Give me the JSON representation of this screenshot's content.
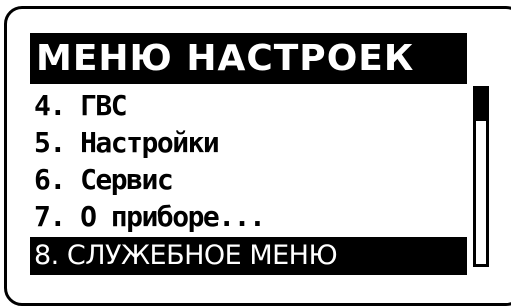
{
  "menu": {
    "title": "МЕНЮ НАСТРОЕК",
    "items": [
      {
        "label": "4. ГВС"
      },
      {
        "label": "5. Настройки"
      },
      {
        "label": "6. Сервис"
      },
      {
        "label": "7. О приборе..."
      },
      {
        "label": "8. СЛУЖЕБНОЕ МЕНЮ",
        "selected": true
      }
    ],
    "scroll_position": 0.0
  }
}
